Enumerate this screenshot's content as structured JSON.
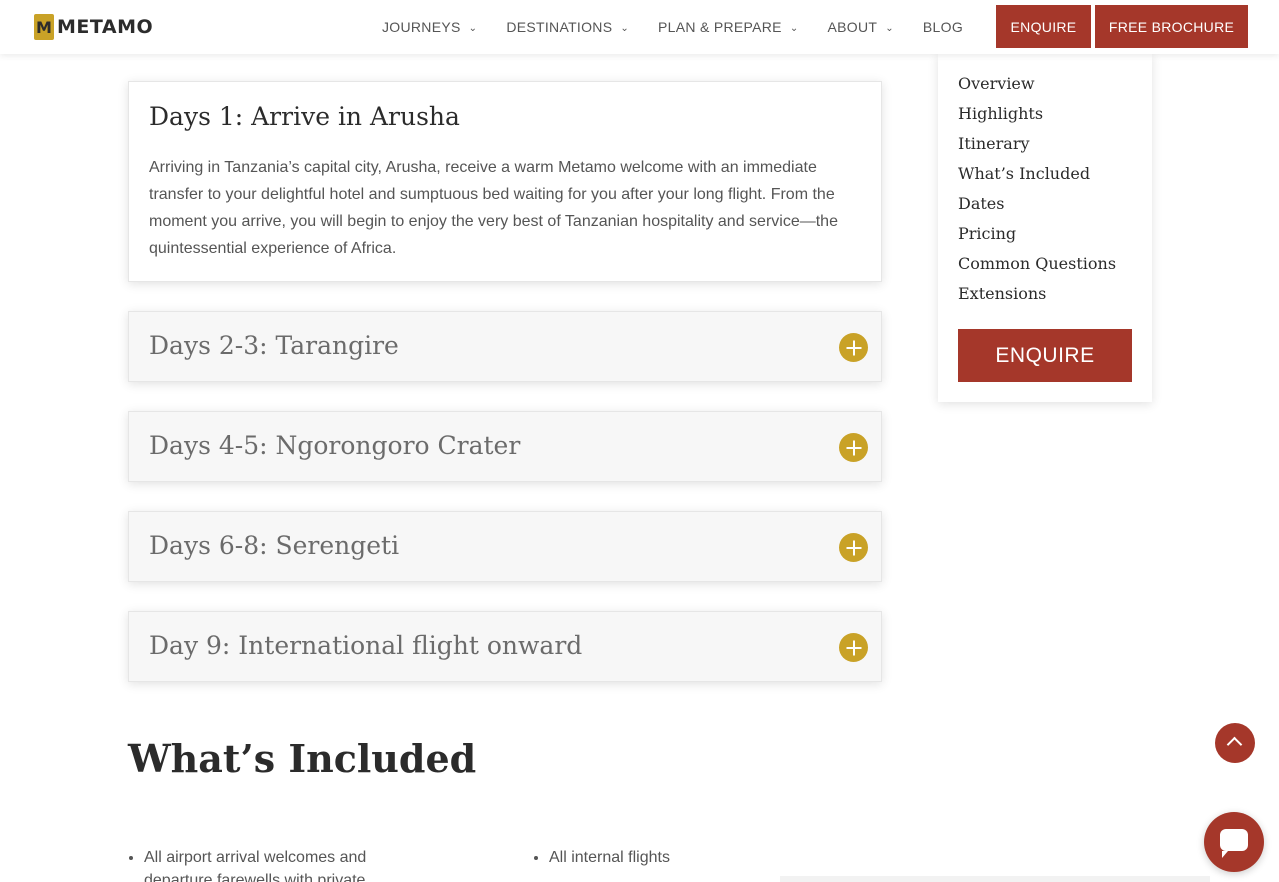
{
  "header": {
    "logo_letter": "M",
    "logo_text": "METAMO",
    "nav": [
      {
        "label": "JOURNEYS",
        "dropdown": true
      },
      {
        "label": "DESTINATIONS",
        "dropdown": true
      },
      {
        "label": "PLAN & PREPARE",
        "dropdown": true
      },
      {
        "label": "ABOUT",
        "dropdown": true
      },
      {
        "label": "BLOG",
        "dropdown": false
      }
    ],
    "enquire_label": "ENQUIRE",
    "brochure_label": "FREE BROCHURE"
  },
  "itinerary": [
    {
      "title": "Days 1: Arrive in Arusha",
      "open": true,
      "body": "Arriving in Tanzania’s capital city, Arusha, receive a warm Metamo welcome with an immediate transfer to your delightful hotel and sumptuous bed waiting for you after your long flight. From the moment you arrive, you will begin to enjoy the very best of Tanzanian hospitality and service—the quintessential experience of Africa."
    },
    {
      "title": "Days 2-3: Tarangire",
      "open": false
    },
    {
      "title": "Days 4-5: Ngorongoro Crater",
      "open": false
    },
    {
      "title": "Days 6-8: Serengeti",
      "open": false
    },
    {
      "title": "Day 9: International flight onward",
      "open": false
    }
  ],
  "sidebar": {
    "links": [
      "Overview",
      "Highlights",
      "Itinerary",
      "What’s Included",
      "Dates",
      "Pricing",
      "Common Questions",
      "Extensions"
    ],
    "enquire_label": "ENQUIRE"
  },
  "included": {
    "title": "What’s Included",
    "col1": [
      "All airport arrival welcomes and departure farewells with private"
    ],
    "col2": [
      "All internal flights"
    ]
  },
  "colors": {
    "accent_red": "#a5372a",
    "accent_gold": "#c9a227",
    "text_dark": "#2b2b2b"
  },
  "icons": {
    "nav_dropdown": "chevron-down-icon",
    "accordion_toggle": "plus-circle-icon",
    "scroll_top": "chevron-up-icon",
    "chat": "chat-bubble-icon"
  }
}
